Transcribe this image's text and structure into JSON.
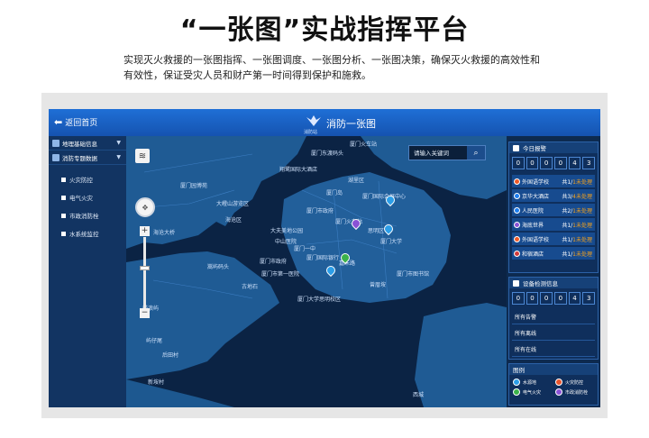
{
  "hero": {
    "title": "“一张图”实战指挥平台",
    "intro_line1": "实现灭火救援的一张图指挥、一张图调度、一张图分析、一张图决策，确保灭火救援的高效性和",
    "intro_line2": "有效性，保证受灾人员和财产第一时间得到保护和施救。"
  },
  "topbar": {
    "back_label": "返回首页",
    "logo_text": "消防站",
    "title": "消防一张图"
  },
  "sidebar": {
    "groups": [
      {
        "label": "地理基础信息",
        "icon": "layers-icon"
      },
      {
        "label": "消防专题数据",
        "icon": "database-icon"
      }
    ],
    "items": [
      {
        "label": "火灾防控"
      },
      {
        "label": "电气火灾"
      },
      {
        "label": "市政消防栓"
      },
      {
        "label": "水系统监控"
      }
    ]
  },
  "map": {
    "search_placeholder": "请输入关键词",
    "labels": [
      "厦门东渡码头",
      "厦门火车站",
      "湖里区",
      "翔鹭国际大酒店",
      "厦门国际会展中心",
      "厦门岛",
      "大嶝山游览区",
      "海沧区",
      "大夫美地公园",
      "海沧大桥",
      "嵩屿码头",
      "厦门一中",
      "中山医院",
      "思明区",
      "厦门大学",
      "厦门国际银行",
      "厦门市第一医院",
      "厦门火车站",
      "嘉禾路",
      "古地石",
      "厦门大学思明校区",
      "厦门市政府",
      "厦门市图书馆",
      "屿仔尾",
      "后田村",
      "新垵村",
      "鼓浪屿",
      "西城",
      "曾厝垵",
      "厦门园博苑",
      "厦门市政府"
    ]
  },
  "alarm_panel": {
    "title": "今日报警",
    "digits": [
      "0",
      "0",
      "0",
      "0",
      "4",
      "3"
    ],
    "rows": [
      {
        "name": "外国语学校",
        "count_prefix": "共1/",
        "unhandled": "1未处理",
        "color": "#f05a28"
      },
      {
        "name": "京华大酒店",
        "count_prefix": "共3/",
        "unhandled": "4未处理",
        "color": "#1c7ef0"
      },
      {
        "name": "人民医院",
        "count_prefix": "共2/",
        "unhandled": "1未处理",
        "color": "#1c7ef0"
      },
      {
        "name": "海底世界",
        "count_prefix": "共1/",
        "unhandled": "1未处理",
        "color": "#8a52d6"
      },
      {
        "name": "外国语学校",
        "count_prefix": "共1/",
        "unhandled": "1未处理",
        "color": "#f05a28"
      },
      {
        "name": "和宿酒店",
        "count_prefix": "共1/",
        "unhandled": "1未处理",
        "color": "#d23b3b"
      }
    ]
  },
  "device_panel": {
    "title": "设备检测信息",
    "digits": [
      "0",
      "0",
      "0",
      "0",
      "4",
      "3"
    ],
    "rows": [
      "所有告警",
      "所有离线",
      "所有在线"
    ]
  },
  "legend_panel": {
    "title": "图例",
    "items": [
      {
        "label": "水源地",
        "color": "#2c9ee8"
      },
      {
        "label": "火灾防控",
        "color": "#e8542c"
      },
      {
        "label": "电气火灾",
        "color": "#3bb24a"
      },
      {
        "label": "市政消防栓",
        "color": "#8a52d6"
      }
    ]
  },
  "colors": {
    "topbar": "#1a63c8",
    "map_water": "#0b2344",
    "map_land": "#1f5b94",
    "sidebar": "#123462",
    "unhandled": "#f6a21b"
  }
}
